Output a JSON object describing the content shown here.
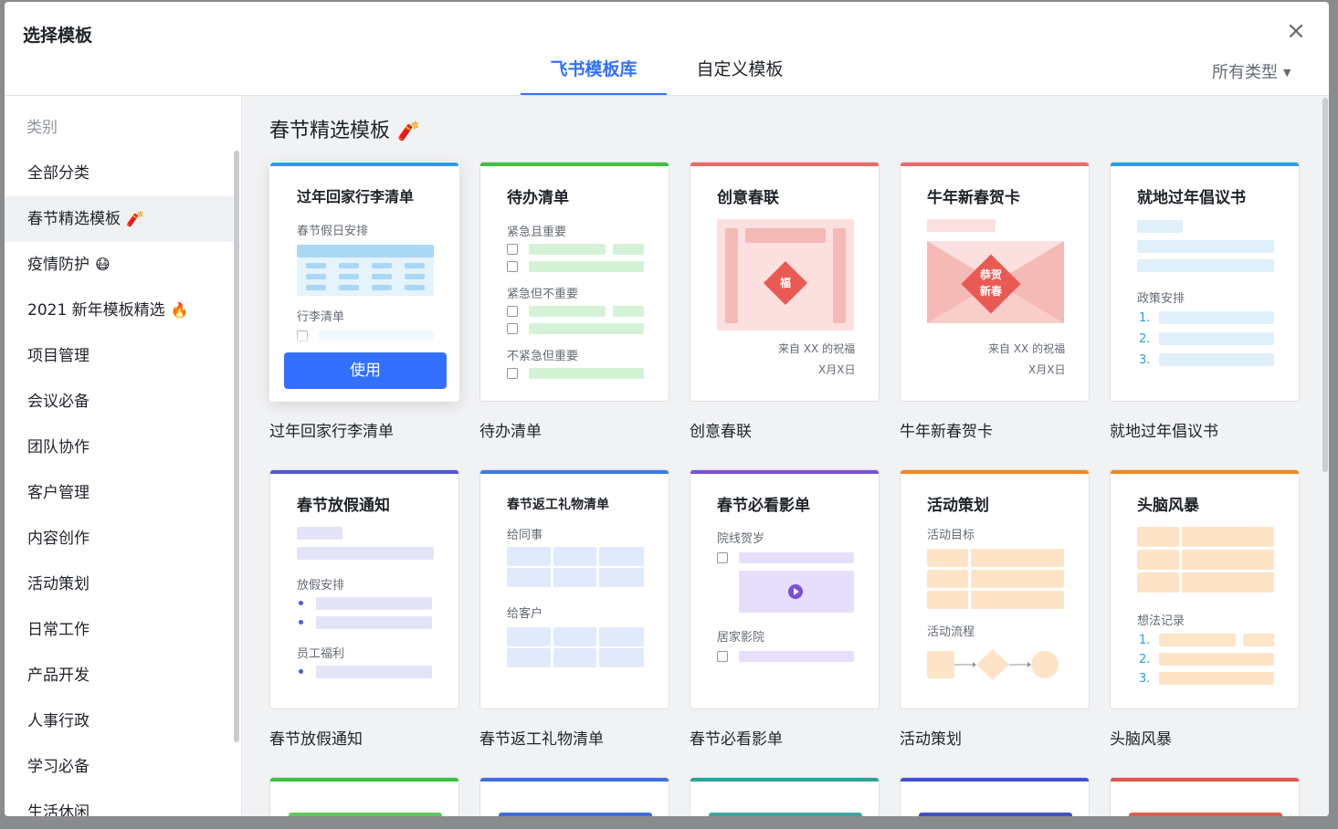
{
  "dialog": {
    "title": "选择模板",
    "close_glyph": "×",
    "tabs": [
      {
        "label": "飞书模板库",
        "active": true
      },
      {
        "label": "自定义模板",
        "active": false
      }
    ],
    "type_filter": "所有类型",
    "type_filter_caret": "▼"
  },
  "sidebar": {
    "header": "类别",
    "items": [
      {
        "label": "全部分类",
        "emoji": ""
      },
      {
        "label": "春节精选模板",
        "emoji": "🧨",
        "active": true
      },
      {
        "label": "疫情防护",
        "emoji": "😷"
      },
      {
        "label": "2021 新年模板精选",
        "emoji": "🔥"
      },
      {
        "label": "项目管理",
        "emoji": ""
      },
      {
        "label": "会议必备",
        "emoji": ""
      },
      {
        "label": "团队协作",
        "emoji": ""
      },
      {
        "label": "客户管理",
        "emoji": ""
      },
      {
        "label": "内容创作",
        "emoji": ""
      },
      {
        "label": "活动策划",
        "emoji": ""
      },
      {
        "label": "日常工作",
        "emoji": ""
      },
      {
        "label": "产品开发",
        "emoji": ""
      },
      {
        "label": "人事行政",
        "emoji": ""
      },
      {
        "label": "学习必备",
        "emoji": ""
      },
      {
        "label": "生活休闲",
        "emoji": ""
      }
    ]
  },
  "section": {
    "title": "春节精选模板",
    "emoji": "🧨"
  },
  "use_button": "使用",
  "cards": [
    {
      "label": "过年回家行李清单",
      "title": "过年回家行李清单",
      "accent": "#2b9ce8",
      "subs": [
        "春节假日安排",
        "行李清单"
      ]
    },
    {
      "label": "待办清单",
      "title": "待办清单",
      "accent": "#3ac341",
      "subs": [
        "紧急且重要",
        "紧急但不重要",
        "不紧急但重要"
      ]
    },
    {
      "label": "创意春联",
      "title": "创意春联",
      "accent": "#ea6b66",
      "stamp": "福",
      "sign": [
        "来自 XX 的祝福",
        "X月X日"
      ]
    },
    {
      "label": "牛年新春贺卡",
      "title": "牛年新春贺卡",
      "accent": "#ea6b66",
      "stamp": "恭贺\n新春",
      "sign": [
        "来自 XX 的祝福",
        "X月X日"
      ]
    },
    {
      "label": "就地过年倡议书",
      "title": "就地过年倡议书",
      "accent": "#2b9ce8",
      "subs": [
        "政策安排"
      ],
      "nums": [
        "1.",
        "2.",
        "3."
      ]
    },
    {
      "label": "春节放假通知",
      "title": "春节放假通知",
      "accent": "#5057d8",
      "subs": [
        "放假安排",
        "员工福利"
      ]
    },
    {
      "label": "春节返工礼物清单",
      "title": "春节返工礼物清单",
      "accent": "#3d7ae8",
      "subs": [
        "给同事",
        "给客户"
      ]
    },
    {
      "label": "春节必看影单",
      "title": "春节必看影单",
      "accent": "#7a4fd9",
      "subs": [
        "院线贺岁",
        "居家影院"
      ]
    },
    {
      "label": "活动策划",
      "title": "活动策划",
      "accent": "#f0891f",
      "subs": [
        "活动目标",
        "活动流程"
      ]
    },
    {
      "label": "头脑风暴",
      "title": "头脑风暴",
      "accent": "#f0891f",
      "subs": [
        "想法记录"
      ],
      "nums": [
        "1.",
        "2.",
        "3."
      ]
    }
  ],
  "partial_cards": [
    {
      "accent": "#3ac341",
      "block": "#5cc95e"
    },
    {
      "accent": "#3d6ee0",
      "block": "#3d6ee0"
    },
    {
      "accent": "#2aa49a",
      "block": "#3aa89e"
    },
    {
      "accent": "#4150d0",
      "block": "#4250c8"
    },
    {
      "accent": "#e0534b",
      "block": "#e05a52"
    }
  ]
}
